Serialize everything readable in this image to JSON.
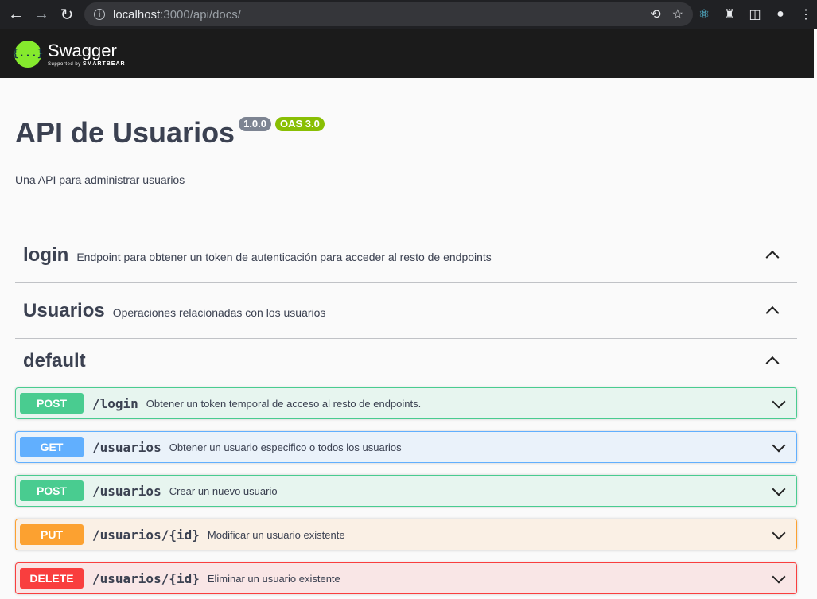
{
  "browser": {
    "url_host": "localhost",
    "url_path": ":3000/api/docs/"
  },
  "topbar": {
    "logo_mark": "{...}",
    "logo_name": "Swagger",
    "logo_sub_prefix": "Supported by ",
    "logo_sub_brand": "SMARTBEAR"
  },
  "info": {
    "title": "API de Usuarios",
    "version": "1.0.0",
    "oas": "OAS 3.0",
    "description": "Una API para administrar usuarios"
  },
  "tags": [
    {
      "name": "login",
      "description": "Endpoint para obtener un token de autenticación para acceder al resto de endpoints"
    },
    {
      "name": "Usuarios",
      "description": "Operaciones relacionadas con los usuarios"
    },
    {
      "name": "default",
      "description": ""
    }
  ],
  "operations": [
    {
      "method": "POST",
      "path": "/login",
      "summary": "Obtener un token temporal de acceso al resto de endpoints."
    },
    {
      "method": "GET",
      "path": "/usuarios",
      "summary": "Obtener un usuario especifico o todos los usuarios"
    },
    {
      "method": "POST",
      "path": "/usuarios",
      "summary": "Crear un nuevo usuario"
    },
    {
      "method": "PUT",
      "path": "/usuarios/{id}",
      "summary": "Modificar un usuario existente"
    },
    {
      "method": "DELETE",
      "path": "/usuarios/{id}",
      "summary": "Eliminar un usuario existente"
    }
  ],
  "colors": {
    "post": "#49cc90",
    "get": "#61affe",
    "put": "#fca130",
    "delete": "#f93e3e",
    "swagger_green": "#85ea2d"
  }
}
